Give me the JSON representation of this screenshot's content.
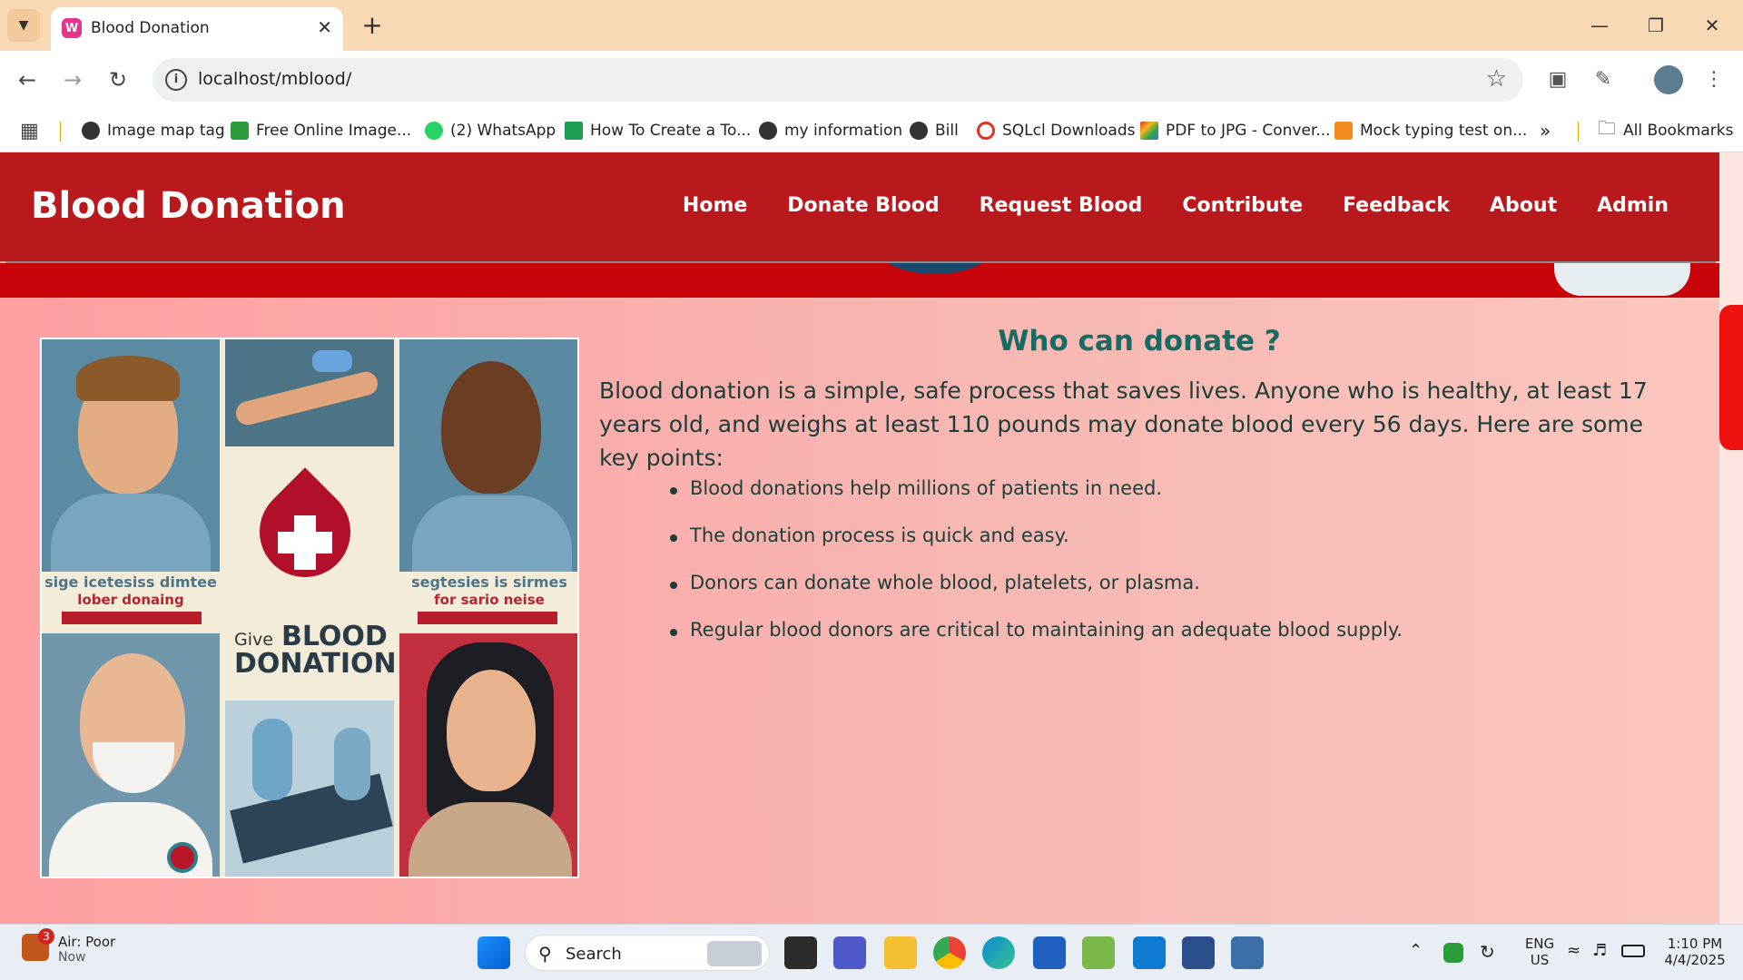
{
  "browser": {
    "tab_title": "Blood Donation",
    "url": "localhost/mblood/",
    "bookmarks": [
      "Image map tag",
      "Free Online Image...",
      "(2) WhatsApp",
      "How To Create a To...",
      "my information",
      "Bill",
      "SQLcl Downloads",
      "PDF to JPG - Conver...",
      "Mock typing test on..."
    ],
    "all_bookmarks": "All Bookmarks"
  },
  "site": {
    "brand": "Blood Donation",
    "nav": [
      "Home",
      "Donate Blood",
      "Request Blood",
      "Contribute",
      "Feedback",
      "About",
      "Admin"
    ]
  },
  "poster": {
    "give": "Give",
    "blood": "BLOOD",
    "donation": "DONATION",
    "caption_left_1": "sige icetesiss dimtee",
    "caption_left_2": "lober donaing",
    "caption_right_1": "segtesies is sirmes",
    "caption_right_2": "for sario neise"
  },
  "section": {
    "heading": "Who can donate ?",
    "intro": "Blood donation is a simple, safe process that saves lives. Anyone who is healthy, at least 17 years old, and weighs at least 110 pounds may donate blood every 56 days. Here are some key points:",
    "points": [
      "Blood donations help millions of patients in need.",
      "The donation process is quick and easy.",
      "Donors can donate whole blood, platelets, or plasma.",
      "Regular blood donors are critical to maintaining an adequate blood supply."
    ]
  },
  "taskbar": {
    "weather_title": "Air: Poor",
    "weather_sub": "Now",
    "weather_badge": "3",
    "search_label": "Search",
    "lang_1": "ENG",
    "lang_2": "US",
    "time": "1:10 PM",
    "date": "4/4/2025"
  },
  "colors": {
    "header_red": "#b9191c",
    "heading_teal": "#176b63",
    "scroll_thumb": "#ef1010"
  }
}
